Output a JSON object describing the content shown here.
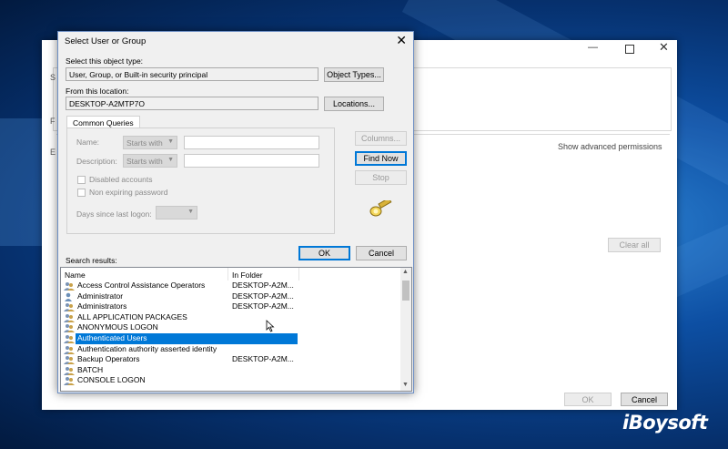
{
  "background_window": {
    "right_link": "Show advanced permissions",
    "clear_all_label": "Clear all",
    "ok_label": "OK",
    "cancel_label": "Cancel",
    "edge_letters": [
      "S",
      "F",
      "E"
    ]
  },
  "dialog": {
    "title": "Select User or Group",
    "object_type_label": "Select this object type:",
    "object_type_value": "User, Group, or Built-in security principal",
    "object_types_button": "Object Types...",
    "location_label": "From this location:",
    "location_value": "DESKTOP-A2MTP7O",
    "locations_button": "Locations...",
    "tab_label": "Common Queries",
    "name_label": "Name:",
    "name_match": "Starts with",
    "description_label": "Description:",
    "description_match": "Starts with",
    "disabled_accounts": "Disabled accounts",
    "non_expiring_password": "Non expiring password",
    "days_since_logon": "Days since last logon:",
    "columns_button": "Columns...",
    "find_now_button": "Find Now",
    "stop_button": "Stop",
    "ok_button": "OK",
    "cancel_button": "Cancel",
    "search_results_label": "Search results:",
    "columns": [
      "Name",
      "In Folder"
    ],
    "rows": [
      {
        "name": "Access Control Assistance Operators",
        "folder": "DESKTOP-A2M...",
        "icon": "group-icon"
      },
      {
        "name": "Administrator",
        "folder": "DESKTOP-A2M...",
        "icon": "user-icon"
      },
      {
        "name": "Administrators",
        "folder": "DESKTOP-A2M...",
        "icon": "group-icon"
      },
      {
        "name": "ALL APPLICATION PACKAGES",
        "folder": "",
        "icon": "group-icon"
      },
      {
        "name": "ANONYMOUS LOGON",
        "folder": "",
        "icon": "group-icon"
      },
      {
        "name": "Authenticated Users",
        "folder": "",
        "icon": "group-icon",
        "selected": true
      },
      {
        "name": "Authentication authority asserted identity",
        "folder": "",
        "icon": "group-icon"
      },
      {
        "name": "Backup Operators",
        "folder": "DESKTOP-A2M...",
        "icon": "group-icon"
      },
      {
        "name": "BATCH",
        "folder": "",
        "icon": "group-icon"
      },
      {
        "name": "CONSOLE LOGON",
        "folder": "",
        "icon": "group-icon"
      }
    ]
  },
  "watermark": "iBoysoft",
  "colors": {
    "selection": "#0078d7",
    "accent_border": "#0078d7"
  }
}
